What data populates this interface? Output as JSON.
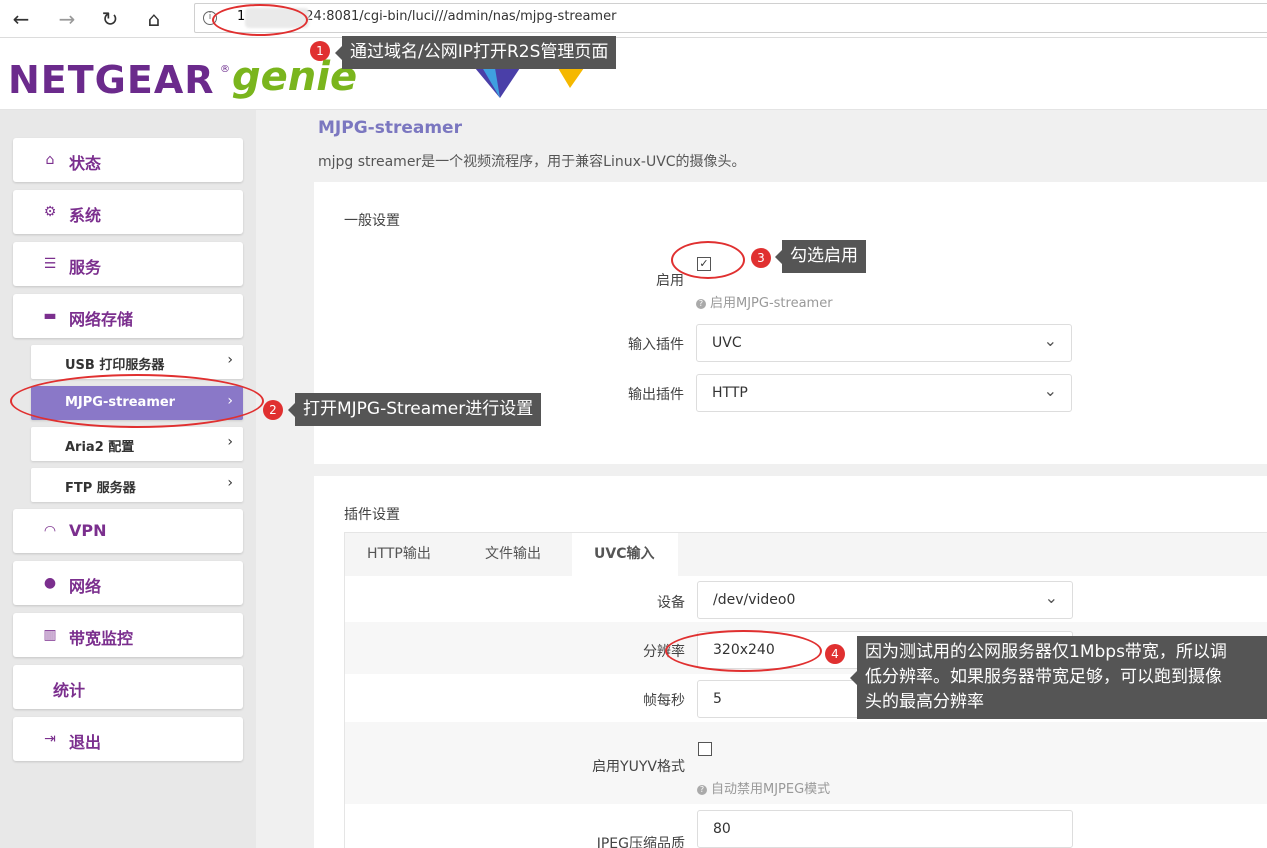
{
  "browser": {
    "url_prefix": "1",
    "url_rest": "24:8081/cgi-bin/luci///admin/nas/mjpg-streamer"
  },
  "header": {
    "brand": "NETGEAR",
    "reg": "®",
    "product": "genie"
  },
  "sidebar": {
    "items": [
      {
        "label": "状态",
        "icon": "home-icon"
      },
      {
        "label": "系统",
        "icon": "gears-icon"
      },
      {
        "label": "服务",
        "icon": "list-icon"
      },
      {
        "label": "网络存储",
        "icon": "storage-icon"
      },
      {
        "label": "VPN",
        "icon": "gauge-icon"
      },
      {
        "label": "网络",
        "icon": "globe-icon"
      },
      {
        "label": "带宽监控",
        "icon": "bar-chart-icon"
      },
      {
        "label": "统计",
        "icon": ""
      },
      {
        "label": "退出",
        "icon": "logout-icon"
      }
    ],
    "sub_items": [
      {
        "label": "USB 打印服务器"
      },
      {
        "label": "MJPG-streamer"
      },
      {
        "label": "Aria2 配置"
      },
      {
        "label": "FTP 服务器"
      }
    ]
  },
  "main": {
    "title": "MJPG-streamer",
    "description": "mjpg streamer是一个视频流程序，用于兼容Linux-UVC的摄像头。",
    "general": {
      "section_title": "一般设置",
      "enable_label": "启用",
      "enable_hint": "启用MJPG-streamer",
      "input_plugin_label": "输入插件",
      "input_plugin_value": "UVC",
      "output_plugin_label": "输出插件",
      "output_plugin_value": "HTTP"
    },
    "plugin": {
      "section_title": "插件设置",
      "tabs": [
        "HTTP输出",
        "文件输出",
        "UVC输入"
      ],
      "device_label": "设备",
      "device_value": "/dev/video0",
      "resolution_label": "分辨率",
      "resolution_value": "320x240",
      "fps_label": "帧每秒",
      "fps_value": "5",
      "yuyv_label": "启用YUYV格式",
      "yuyv_hint": "自动禁用MJPEG模式",
      "jpeg_label": "JPEG压缩品质",
      "jpeg_value": "80"
    }
  },
  "annotations": [
    {
      "number": "1",
      "text": "通过域名/公网IP打开R2S管理页面"
    },
    {
      "number": "2",
      "text": "打开MJPG-Streamer进行设置"
    },
    {
      "number": "3",
      "text": "勾选启用"
    },
    {
      "number": "4",
      "text_line1": "因为测试用的公网服务器仅1Mbps带宽，所以调",
      "text_line2": "低分辨率。如果服务器带宽足够，可以跑到摄像",
      "text_line3": "头的最高分辨率"
    }
  ],
  "colors": {
    "brand_purple": "#7b2f8e",
    "active_sub": "#8a78c8",
    "genie_green": "#7ab51d",
    "annotation_red": "#e03030",
    "callout_bg": "#555555"
  }
}
